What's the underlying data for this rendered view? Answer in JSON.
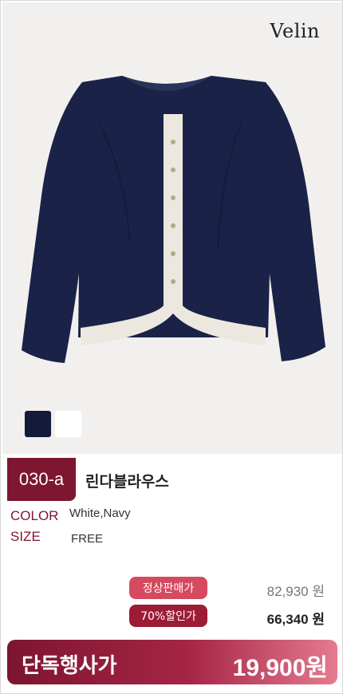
{
  "brand": {
    "logo_text": "Velin"
  },
  "product": {
    "code": "030-a",
    "name": "린다블라우스",
    "swatches": [
      {
        "name": "navy",
        "color": "#141a3a"
      },
      {
        "name": "white",
        "color": "#ffffff"
      }
    ]
  },
  "details": {
    "color_label": "COLOR",
    "color_value": "White,Navy",
    "size_label": "SIZE",
    "size_value": "FREE"
  },
  "pricing": {
    "regular_label": "정상판매가",
    "regular_price": "82,930 원",
    "discount_label": "70%할인가",
    "discount_price": "66,340 원"
  },
  "promo": {
    "label": "단독행사가",
    "price": "19,900원"
  }
}
